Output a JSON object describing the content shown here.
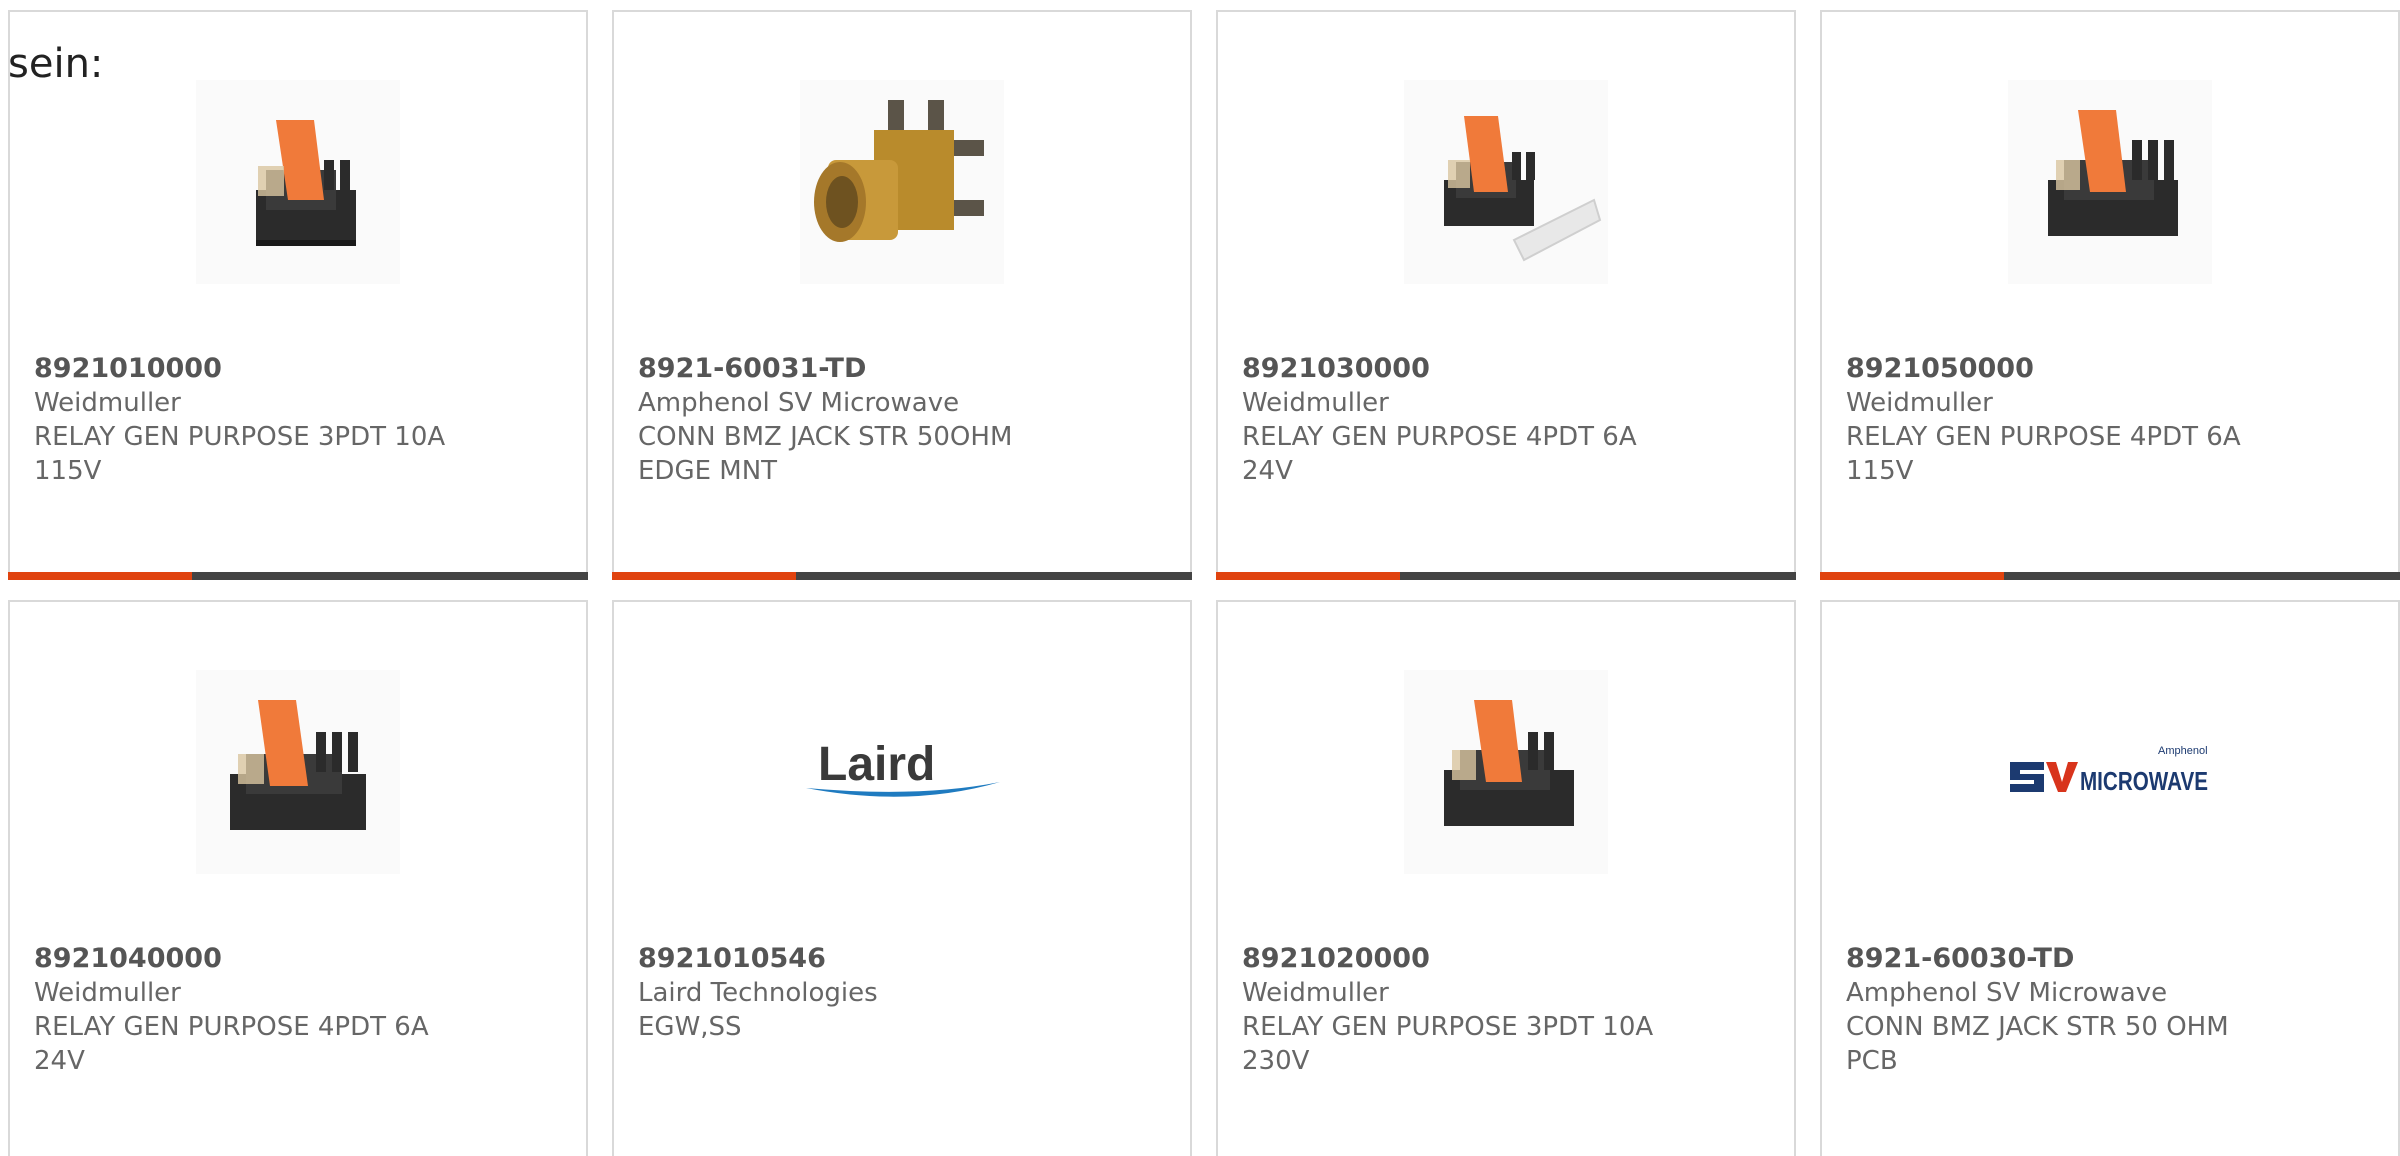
{
  "intro": "sein:",
  "products": [
    {
      "part": "8921010000",
      "maker": "Weidmuller",
      "desc1": "RELAY GEN PURPOSE 3PDT 10A",
      "desc2": "115V",
      "image": "relay-image"
    },
    {
      "part": "8921-60031-TD",
      "maker": "Amphenol SV Microwave",
      "desc1": "CONN BMZ JACK STR 50OHM",
      "desc2": "EDGE MNT",
      "image": "connector-image"
    },
    {
      "part": "8921030000",
      "maker": "Weidmuller",
      "desc1": "RELAY GEN PURPOSE 4PDT 6A",
      "desc2": "24V",
      "image": "relay-with-marker-image"
    },
    {
      "part": "8921050000",
      "maker": "Weidmuller",
      "desc1": "RELAY GEN PURPOSE 4PDT 6A",
      "desc2": "115V",
      "image": "relay-image"
    },
    {
      "part": "8921040000",
      "maker": "Weidmuller",
      "desc1": "RELAY GEN PURPOSE 4PDT 6A",
      "desc2": "24V",
      "image": "relay-image"
    },
    {
      "part": "8921010546",
      "maker": "Laird Technologies",
      "desc1": "EGW,SS",
      "desc2": "",
      "image": "laird-logo",
      "logo_text": "Laird"
    },
    {
      "part": "8921020000",
      "maker": "Weidmuller",
      "desc1": "RELAY GEN PURPOSE 3PDT 10A",
      "desc2": "230V",
      "image": "relay-image"
    },
    {
      "part": "8921-60030-TD",
      "maker": "Amphenol SV Microwave",
      "desc1": "CONN BMZ JACK STR 50 OHM",
      "desc2": "PCB",
      "image": "sv-microwave-logo",
      "logo_text": "MICROWAVE",
      "logo_sub": "Amphenol"
    }
  ],
  "colors": {
    "accent": "#e0430f",
    "bar": "#444444",
    "relay_orange": "#f07a3a",
    "relay_black": "#2b2b2b",
    "connector_gold": "#b98b2c",
    "laird_blue": "#1f7bc0",
    "sv_navy": "#1c3a70"
  }
}
